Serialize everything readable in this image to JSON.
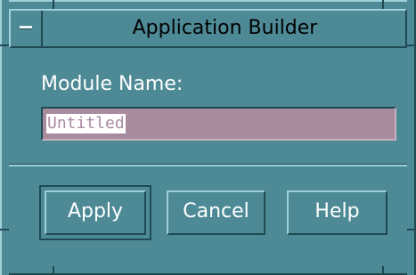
{
  "window": {
    "title": "Application Builder"
  },
  "form": {
    "module_name_label": "Module Name:",
    "module_name_value": "Untitled"
  },
  "buttons": {
    "apply": "Apply",
    "cancel": "Cancel",
    "help": "Help"
  },
  "colors": {
    "background": "#4e8a96",
    "field": "#a98ba0",
    "text_light": "#ffffff",
    "title_text": "#000000"
  }
}
